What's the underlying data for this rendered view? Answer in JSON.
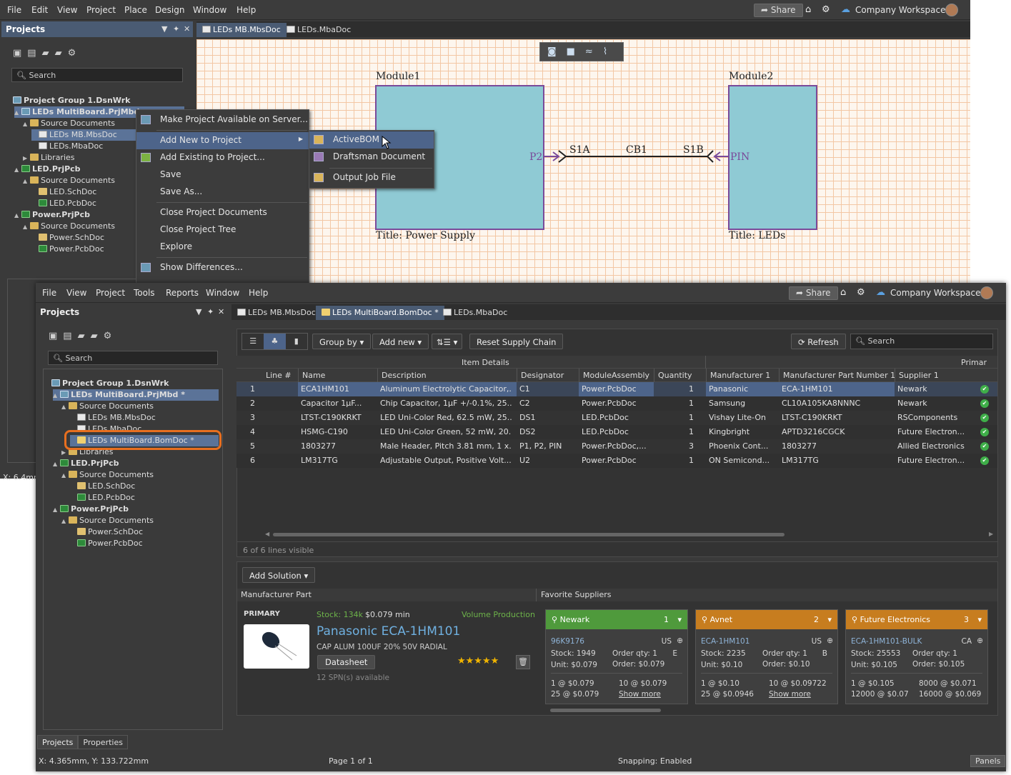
{
  "win1": {
    "menu": [
      "File",
      "Edit",
      "View",
      "Project",
      "Place",
      "Design",
      "Window",
      "Help"
    ],
    "share": "Share",
    "workspace": "Company Workspace",
    "projects_title": "Projects",
    "search_placeholder": "Search",
    "tree": [
      {
        "label": "Project Group 1.DsnWrk",
        "indent": 0,
        "icon": "proj",
        "bold": true,
        "tw": ""
      },
      {
        "label": "LEDs MultiBoard.PrjMbd",
        "indent": 1,
        "icon": "proj",
        "bold": true,
        "tw": "▲",
        "sel": true
      },
      {
        "label": "Source Documents",
        "indent": 2,
        "icon": "folder",
        "tw": "▲"
      },
      {
        "label": "LEDs MB.MbsDoc",
        "indent": 3,
        "icon": "doc",
        "sel": true
      },
      {
        "label": "LEDs.MbaDoc",
        "indent": 3,
        "icon": "doc"
      },
      {
        "label": "Libraries",
        "indent": 2,
        "icon": "folder",
        "tw": "▶"
      },
      {
        "label": "LED.PrjPcb",
        "indent": 1,
        "icon": "pcb",
        "bold": true,
        "tw": "▲"
      },
      {
        "label": "Source Documents",
        "indent": 2,
        "icon": "folder",
        "tw": "▲"
      },
      {
        "label": "LED.SchDoc",
        "indent": 3,
        "icon": "sch"
      },
      {
        "label": "LED.PcbDoc",
        "indent": 3,
        "icon": "pcb"
      },
      {
        "label": "Power.PrjPcb",
        "indent": 1,
        "icon": "pcb",
        "bold": true,
        "tw": "▲"
      },
      {
        "label": "Source Documents",
        "indent": 2,
        "icon": "folder",
        "tw": "▲"
      },
      {
        "label": "Power.SchDoc",
        "indent": 3,
        "icon": "sch"
      },
      {
        "label": "Power.PcbDoc",
        "indent": 3,
        "icon": "pcb"
      }
    ],
    "tabs": [
      "LEDs MB.MbsDoc",
      "LEDs.MbaDoc"
    ],
    "status_x": "X: 6.4mm",
    "context_menu": [
      "Make Project Available on Server...",
      "Add New to Project",
      "Add Existing to Project...",
      "Save",
      "Save As...",
      "Close Project Documents",
      "Close Project Tree",
      "Explore",
      "Show Differences..."
    ],
    "submenu": [
      "ActiveBOM",
      "Draftsman Document",
      "Output Job File"
    ],
    "schematic": {
      "module1": "Module1",
      "module2": "Module2",
      "title1": "Title: Power Supply",
      "title2": "Title: LEDs",
      "p2": "P2",
      "pin": "PIN",
      "s1a": "S1A",
      "cb1": "CB1",
      "s1b": "S1B"
    }
  },
  "win2": {
    "menu": [
      "File",
      "View",
      "Project",
      "Tools",
      "Reports",
      "Window",
      "Help"
    ],
    "share": "Share",
    "workspace": "Company Workspace",
    "projects_title": "Projects",
    "search_placeholder": "Search",
    "tree": [
      {
        "label": "Project Group 1.DsnWrk",
        "indent": 0,
        "icon": "proj",
        "bold": true,
        "tw": ""
      },
      {
        "label": "LEDs MultiBoard.PrjMbd *",
        "indent": 1,
        "icon": "proj",
        "bold": true,
        "tw": "▲",
        "sel": true
      },
      {
        "label": "Source Documents",
        "indent": 2,
        "icon": "folder",
        "tw": "▲"
      },
      {
        "label": "LEDs MB.MbsDoc",
        "indent": 3,
        "icon": "doc"
      },
      {
        "label": "LEDs.MbaDoc",
        "indent": 3,
        "icon": "doc"
      },
      {
        "label": "LEDs MultiBoard.BomDoc *",
        "indent": 3,
        "icon": "bom",
        "sel": true
      },
      {
        "label": "Libraries",
        "indent": 2,
        "icon": "folder",
        "tw": "▶"
      },
      {
        "label": "LED.PrjPcb",
        "indent": 1,
        "icon": "pcb",
        "bold": true,
        "tw": "▲"
      },
      {
        "label": "Source Documents",
        "indent": 2,
        "icon": "folder",
        "tw": "▲"
      },
      {
        "label": "LED.SchDoc",
        "indent": 3,
        "icon": "sch"
      },
      {
        "label": "LED.PcbDoc",
        "indent": 3,
        "icon": "pcb"
      },
      {
        "label": "Power.PrjPcb",
        "indent": 1,
        "icon": "pcb",
        "bold": true,
        "tw": "▲"
      },
      {
        "label": "Source Documents",
        "indent": 2,
        "icon": "folder",
        "tw": "▲"
      },
      {
        "label": "Power.SchDoc",
        "indent": 3,
        "icon": "sch"
      },
      {
        "label": "Power.PcbDoc",
        "indent": 3,
        "icon": "pcb"
      }
    ],
    "tabs": [
      "LEDs MB.MbsDoc",
      "LEDs MultiBoard.BomDoc *",
      "LEDs.MbaDoc"
    ],
    "toolbar": {
      "group_by": "Group by",
      "add_new": "Add new",
      "reset": "Reset Supply Chain",
      "refresh": "Refresh",
      "search": "Search"
    },
    "group_headers": {
      "item_details": "Item Details",
      "primary": "Primar"
    },
    "columns": [
      "Line #",
      "Name",
      "Description",
      "Designator",
      "ModuleAssembly",
      "Quantity",
      "Manufacturer 1",
      "Manufacturer Part Number 1",
      "Supplier 1"
    ],
    "rows": [
      [
        "1",
        "ECA1HM101",
        "Aluminum Electrolytic Capacitor,...",
        "C1",
        "Power.PcbDoc",
        "1",
        "Panasonic",
        "ECA-1HM101",
        "Newark"
      ],
      [
        "2",
        "Capacitor 1µF...",
        "Chip Capacitor, 1µF +/-0.1%, 25...",
        "C2",
        "Power.PcbDoc",
        "1",
        "Samsung",
        "CL10A105KA8NNNC",
        "Newark"
      ],
      [
        "3",
        "LTST-C190KRKT",
        "LED Uni-Color Red, 62.5 mW, 25...",
        "DS1",
        "LED.PcbDoc",
        "1",
        "Vishay Lite-On",
        "LTST-C190KRKT",
        "RSComponents"
      ],
      [
        "4",
        "HSMG-C190",
        "LED Uni-Color Green, 52 mW, 20...",
        "DS2",
        "LED.PcbDoc",
        "1",
        "Kingbright",
        "APTD3216CGCK",
        "Future Electron..."
      ],
      [
        "5",
        "1803277",
        "Male Header, Pitch 3.81 mm, 1 x...",
        "P1, P2, PIN",
        "Power.PcbDoc,...",
        "3",
        "Phoenix Cont...",
        "1803277",
        "Allied Electronics"
      ],
      [
        "6",
        "LM317TG",
        "Adjustable Output, Positive Volt...",
        "U2",
        "Power.PcbDoc",
        "1",
        "ON Semicond...",
        "LM317TG",
        "Future Electron..."
      ]
    ],
    "lines_visible": "6 of 6 lines visible",
    "add_solution": "Add Solution",
    "mfr_part_label": "Manufacturer Part",
    "fav_suppliers_label": "Favorite Suppliers",
    "part": {
      "primary": "PRIMARY",
      "stock": "Stock: 134k",
      "min": "$0.079 min",
      "status": "Volume Production",
      "name": "Panasonic ECA-1HM101",
      "desc": "CAP ALUM 100UF 20% 50V RADIAL",
      "datasheet": "Datasheet",
      "spn": "12 SPN(s) available",
      "stars": "★★★★★",
      "rating": 1.0
    },
    "suppliers": [
      {
        "name": "Newark",
        "rank": "1",
        "color": "#4f9a3c",
        "sku": "96K9176",
        "country": "US",
        "stock": "Stock: 1949",
        "order_qty": "Order qty: 1",
        "order": "Order: $0.079",
        "unit": "Unit: $0.079",
        "extra": "E",
        "p1": "1 @ $0.079",
        "p2": "10 @ $0.079",
        "p3": "25 @ $0.079",
        "more": "Show more"
      },
      {
        "name": "Avnet",
        "rank": "2",
        "color": "#c77d1f",
        "sku": "ECA-1HM101",
        "country": "US",
        "stock": "Stock: 2235",
        "order_qty": "Order qty: 1",
        "order": "Order: $0.10",
        "unit": "Unit: $0.10",
        "extra": "B",
        "p1": "1 @ $0.10",
        "p2": "10 @ $0.09722",
        "p3": "25 @ $0.0946",
        "more": "Show more"
      },
      {
        "name": "Future Electronics",
        "rank": "3",
        "color": "#c77d1f",
        "sku": "ECA-1HM101-BULK",
        "country": "CA",
        "stock": "Stock: 25553",
        "order_qty": "Order qty: 1",
        "order": "Order: $0.105",
        "unit": "Unit: $0.105",
        "extra": "",
        "p1": "1 @ $0.105",
        "p2": "8000 @ $0.071",
        "p3": "12000 @ $0.07",
        "p4": "16000 @ $0.069"
      }
    ],
    "bottom_tabs": [
      "Projects",
      "Properties"
    ],
    "status": {
      "coords": "X: 4.365mm, Y: 133.722mm",
      "page": "Page 1 of 1",
      "snapping": "Snapping: Enabled",
      "panels": "Panels"
    }
  }
}
